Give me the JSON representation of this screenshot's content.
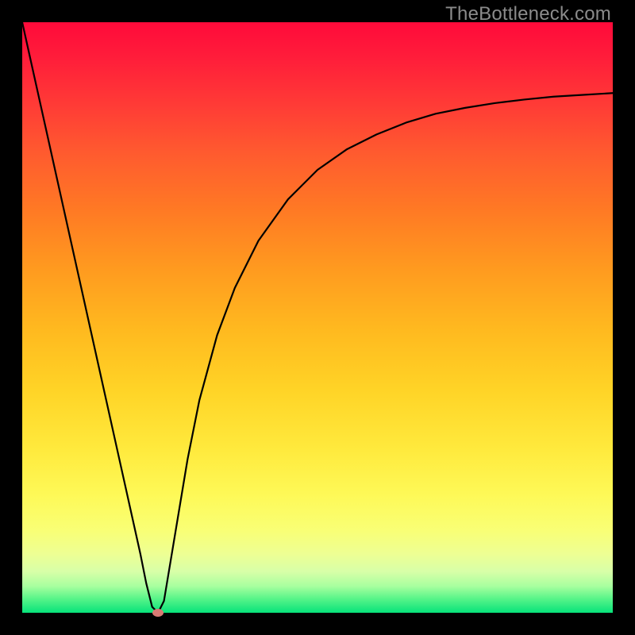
{
  "watermark": {
    "text": "TheBottleneck.com"
  },
  "chart_data": {
    "type": "line",
    "title": "",
    "xlabel": "",
    "ylabel": "",
    "xlim": [
      0,
      100
    ],
    "ylim": [
      0,
      100
    ],
    "grid": false,
    "legend": false,
    "background": "rainbow-vertical-gradient-red-to-green",
    "series": [
      {
        "name": "bottleneck-curve",
        "x": [
          0,
          2,
          4,
          6,
          8,
          10,
          12,
          14,
          16,
          18,
          20,
          21,
          22,
          23,
          24,
          26,
          28,
          30,
          33,
          36,
          40,
          45,
          50,
          55,
          60,
          65,
          70,
          75,
          80,
          85,
          90,
          95,
          100
        ],
        "values": [
          100,
          91,
          82,
          73,
          64,
          55,
          46,
          37,
          28,
          19,
          10,
          5,
          1,
          0,
          2,
          14,
          26,
          36,
          47,
          55,
          63,
          70,
          75,
          78.5,
          81,
          83,
          84.5,
          85.5,
          86.3,
          86.9,
          87.4,
          87.7,
          88
        ]
      }
    ],
    "markers": [
      {
        "name": "minimum-point",
        "x": 23,
        "y": 0,
        "shape": "ellipse",
        "color": "#d87a74"
      }
    ]
  }
}
